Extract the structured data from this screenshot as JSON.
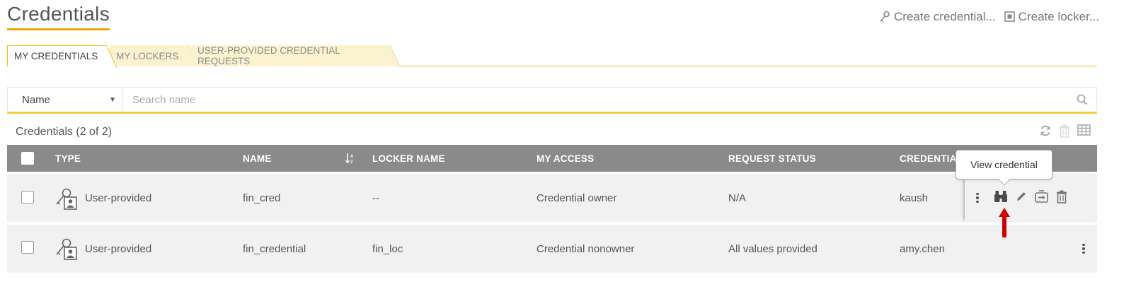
{
  "page": {
    "title": "Credentials"
  },
  "top_actions": {
    "create_credential": "Create credential...",
    "create_locker": "Create locker..."
  },
  "tabs": [
    {
      "label": "MY CREDENTIALS",
      "active": true
    },
    {
      "label": "MY LOCKERS",
      "active": false
    },
    {
      "label": "USER-PROVIDED CREDENTIAL REQUESTS",
      "active": false
    }
  ],
  "search": {
    "field": "Name",
    "placeholder": "Search name"
  },
  "list": {
    "count_label": "Credentials (2 of 2)",
    "tools": [
      "refresh-icon",
      "delete-icon",
      "table-view-icon"
    ]
  },
  "table": {
    "headers": {
      "type": "TYPE",
      "name": "NAME",
      "locker_name": "LOCKER NAME",
      "my_access": "MY ACCESS",
      "request_status": "REQUEST STATUS",
      "credential_owner": "CREDENTIAL"
    },
    "rows": [
      {
        "type": "User-provided",
        "name": "fin_cred",
        "locker_name": "--",
        "my_access": "Credential owner",
        "request_status": "N/A",
        "credential_owner": "kaush"
      },
      {
        "type": "User-provided",
        "name": "fin_credential",
        "locker_name": "fin_loc",
        "my_access": "Credential nonowner",
        "request_status": "All values provided",
        "credential_owner": "amy.chen"
      }
    ],
    "row_actions": [
      "kebab-menu-icon",
      "binoculars-icon",
      "pencil-icon",
      "export-icon",
      "trash-icon"
    ]
  },
  "tooltip": {
    "text": "View credential"
  },
  "colors": {
    "accent": "#f0a300",
    "header_bg": "#8a8a8a",
    "arrow": "#cc0000"
  }
}
